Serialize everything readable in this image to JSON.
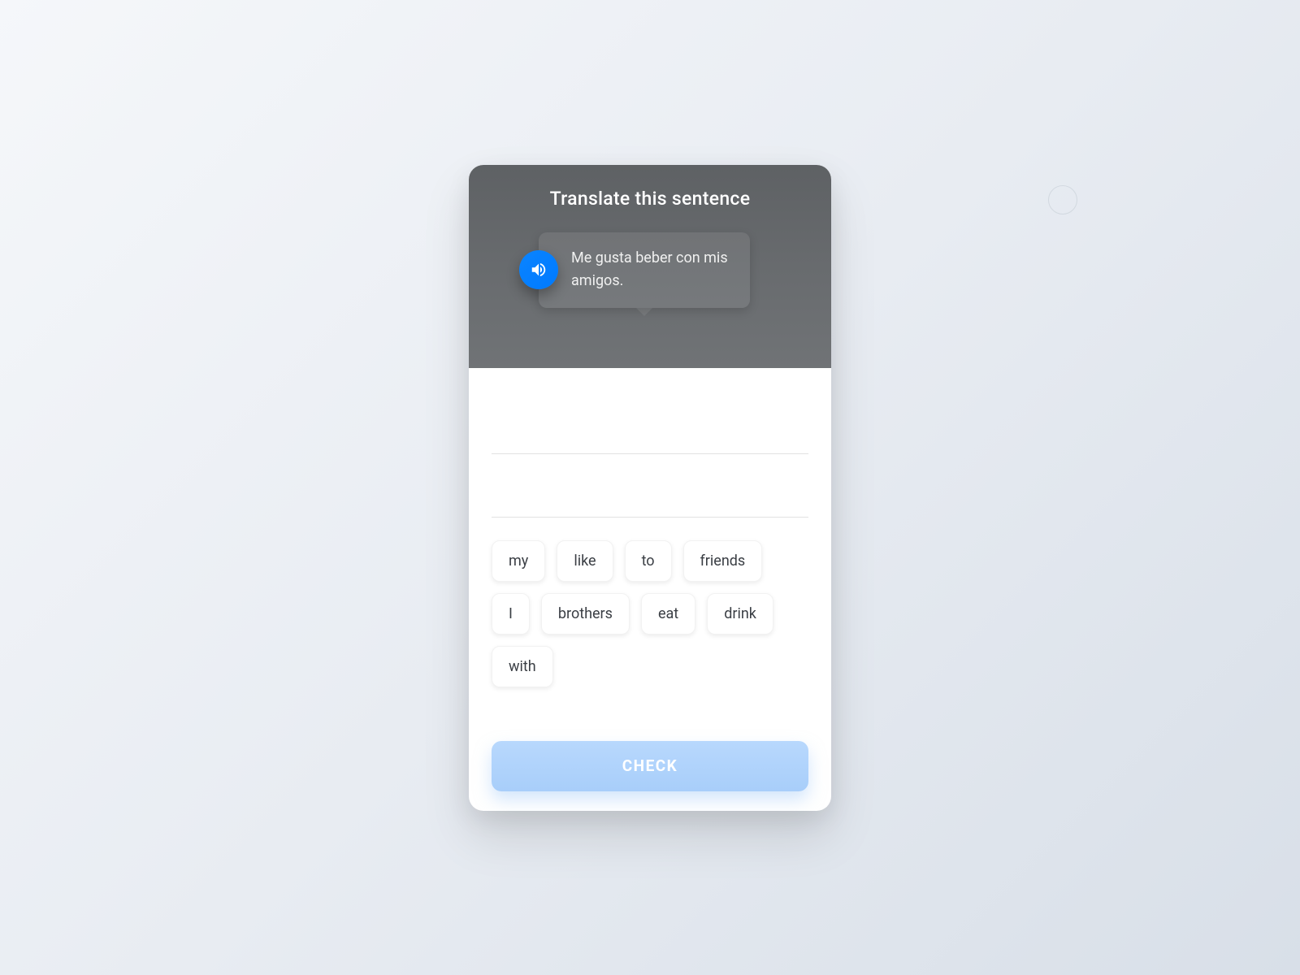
{
  "header": {
    "title": "Translate this sentence",
    "prompt": "Me gusta beber con mis amigos."
  },
  "word_bank": [
    "my",
    "like",
    "to",
    "friends",
    "I",
    "brothers",
    "eat",
    "drink",
    "with"
  ],
  "actions": {
    "check_label": "CHECK"
  }
}
